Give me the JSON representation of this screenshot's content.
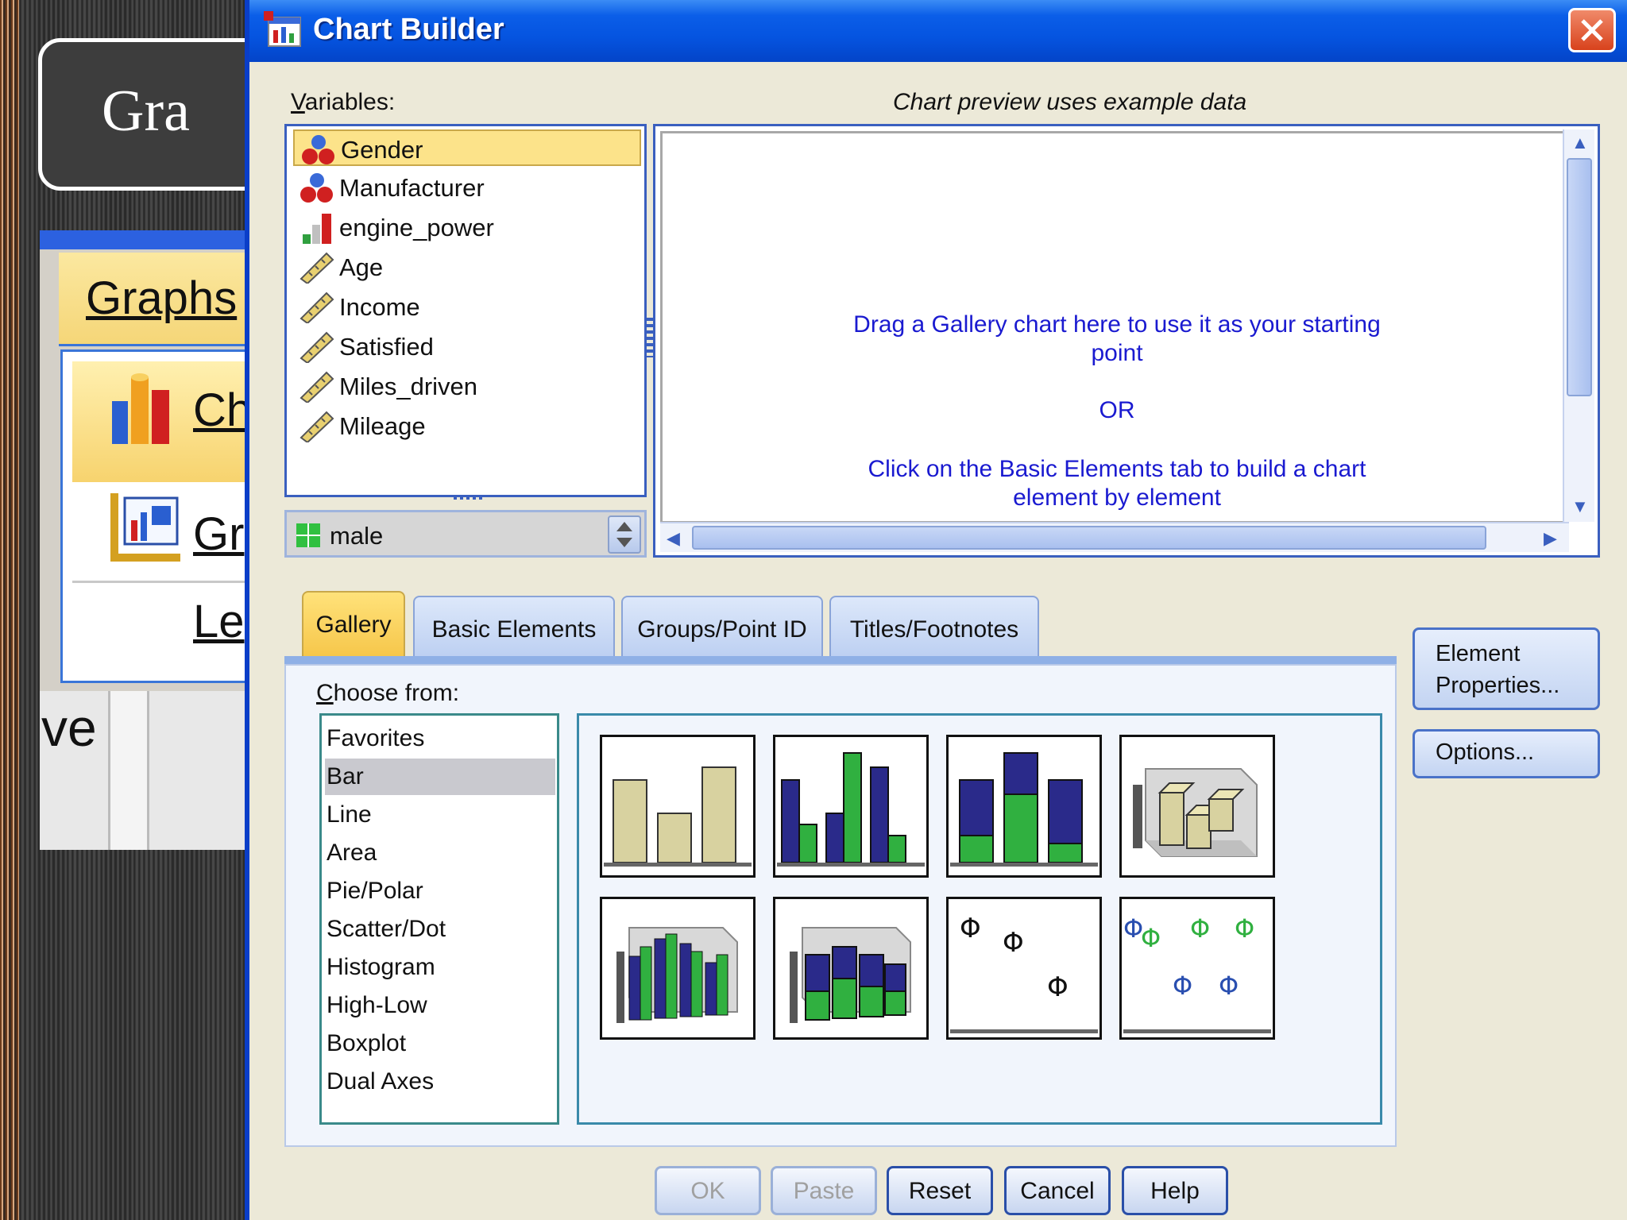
{
  "background_app": {
    "title_fragment": "Gra",
    "menu_label": "Graphs",
    "menu_items": [
      "Ch",
      "Gr",
      "Le"
    ],
    "lower_text": "ve"
  },
  "dialog": {
    "title": "Chart Builder",
    "variables_label": "Variables:",
    "variables_label_mnemonic": "V",
    "variables_label_rest": "ariables:",
    "preview_caption": "Chart preview uses example data",
    "variables": [
      {
        "name": "Gender",
        "icon": "nominal-icon",
        "selected": true
      },
      {
        "name": "Manufacturer",
        "icon": "nominal-icon",
        "selected": false
      },
      {
        "name": "engine_power",
        "icon": "ordinal-icon",
        "selected": false
      },
      {
        "name": "Age",
        "icon": "scale-icon",
        "selected": false
      },
      {
        "name": "Income",
        "icon": "scale-icon",
        "selected": false
      },
      {
        "name": "Satisfied",
        "icon": "scale-icon",
        "selected": false
      },
      {
        "name": "Miles_driven",
        "icon": "scale-icon",
        "selected": false
      },
      {
        "name": "Mileage",
        "icon": "scale-icon",
        "selected": false
      }
    ],
    "category_value": "male",
    "preview_text": {
      "line1": "Drag a Gallery chart here to use it as your starting",
      "line2": "point",
      "or": "OR",
      "line3": "Click on the Basic Elements tab to build a chart",
      "line4": "element by element"
    },
    "tabs": [
      {
        "label": "Gallery",
        "active": true
      },
      {
        "label": "Basic Elements",
        "active": false
      },
      {
        "label": "Groups/Point ID",
        "active": false
      },
      {
        "label": "Titles/Footnotes",
        "active": false
      }
    ],
    "choose_from_label": "Choose from:",
    "choose_from_mnemonic": "C",
    "choose_from_rest": "hoose from:",
    "chart_types": [
      "Favorites",
      "Bar",
      "Line",
      "Area",
      "Pie/Polar",
      "Scatter/Dot",
      "Histogram",
      "High-Low",
      "Boxplot",
      "Dual Axes"
    ],
    "selected_chart_type": "Bar",
    "gallery_thumbnails": [
      "simple-bar-icon",
      "clustered-bar-icon",
      "stacked-bar-icon",
      "simple-3d-bar-icon",
      "clustered-3d-bar-icon",
      "stacked-3d-bar-icon",
      "simple-error-bar-icon",
      "clustered-error-bar-icon"
    ],
    "element_properties_line1": "Element",
    "element_properties_line2": "Properties...",
    "options_label": "Options...",
    "buttons": {
      "ok": "OK",
      "paste": "Paste",
      "reset": "Reset",
      "cancel": "Cancel",
      "help": "Help"
    },
    "colors": {
      "title_bar": "#0554e0",
      "selected_variable": "#fce38a",
      "active_tab": "#f6c64a",
      "bar_khaki": "#d8d2a0",
      "bar_navy": "#2a2a8a",
      "bar_green": "#30b040",
      "hint_text": "#1a1ad0"
    }
  }
}
